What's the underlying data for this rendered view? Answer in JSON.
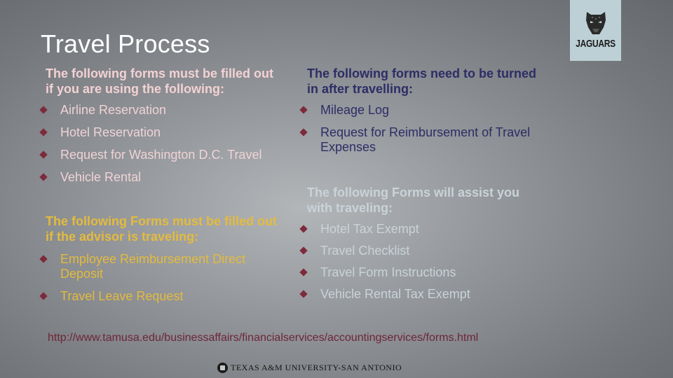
{
  "slide": {
    "title": "Travel Process",
    "logo": {
      "icon": "jaguar-head-icon",
      "wordmark": "JAGUARS"
    },
    "sections": {
      "before_travel": {
        "heading_line1": "The following forms must be filled out",
        "heading_line2": "if you are using the following:",
        "items": [
          "Airline Reservation",
          "Hotel Reservation",
          "Request for Washington D.C. Travel",
          "Vehicle Rental"
        ]
      },
      "after_travel": {
        "heading_line1": "The following forms need to be turned",
        "heading_line2": "in after travelling:",
        "items": [
          "Mileage Log",
          "Request for Reimbursement of Travel Expenses"
        ]
      },
      "assist": {
        "heading_line1": "The following Forms will assist you",
        "heading_line2": "with traveling:",
        "items": [
          "Hotel Tax Exempt",
          "Travel Checklist",
          "Travel Form Instructions",
          "Vehicle Rental Tax Exempt"
        ]
      },
      "advisor": {
        "heading_line1": "The following Forms must be filled out",
        "heading_line2": "if the advisor is traveling:",
        "items": [
          "Employee Reimbursement Direct Deposit",
          "Travel Leave Request"
        ]
      }
    },
    "link": "http://www.tamusa.edu/businessaffairs/financialservices/accountingservices/forms.html",
    "footer": {
      "icon": "university-seal-icon",
      "text": "TEXAS A&M UNIVERSITY-SAN ANTONIO"
    },
    "colors": {
      "bullet": "#7d2a3c",
      "section1": "#f3d2d4",
      "section2": "#2d2d66",
      "section3": "#c9d3d8",
      "section4": "#e3bb3f",
      "link": "#6e2638"
    }
  }
}
